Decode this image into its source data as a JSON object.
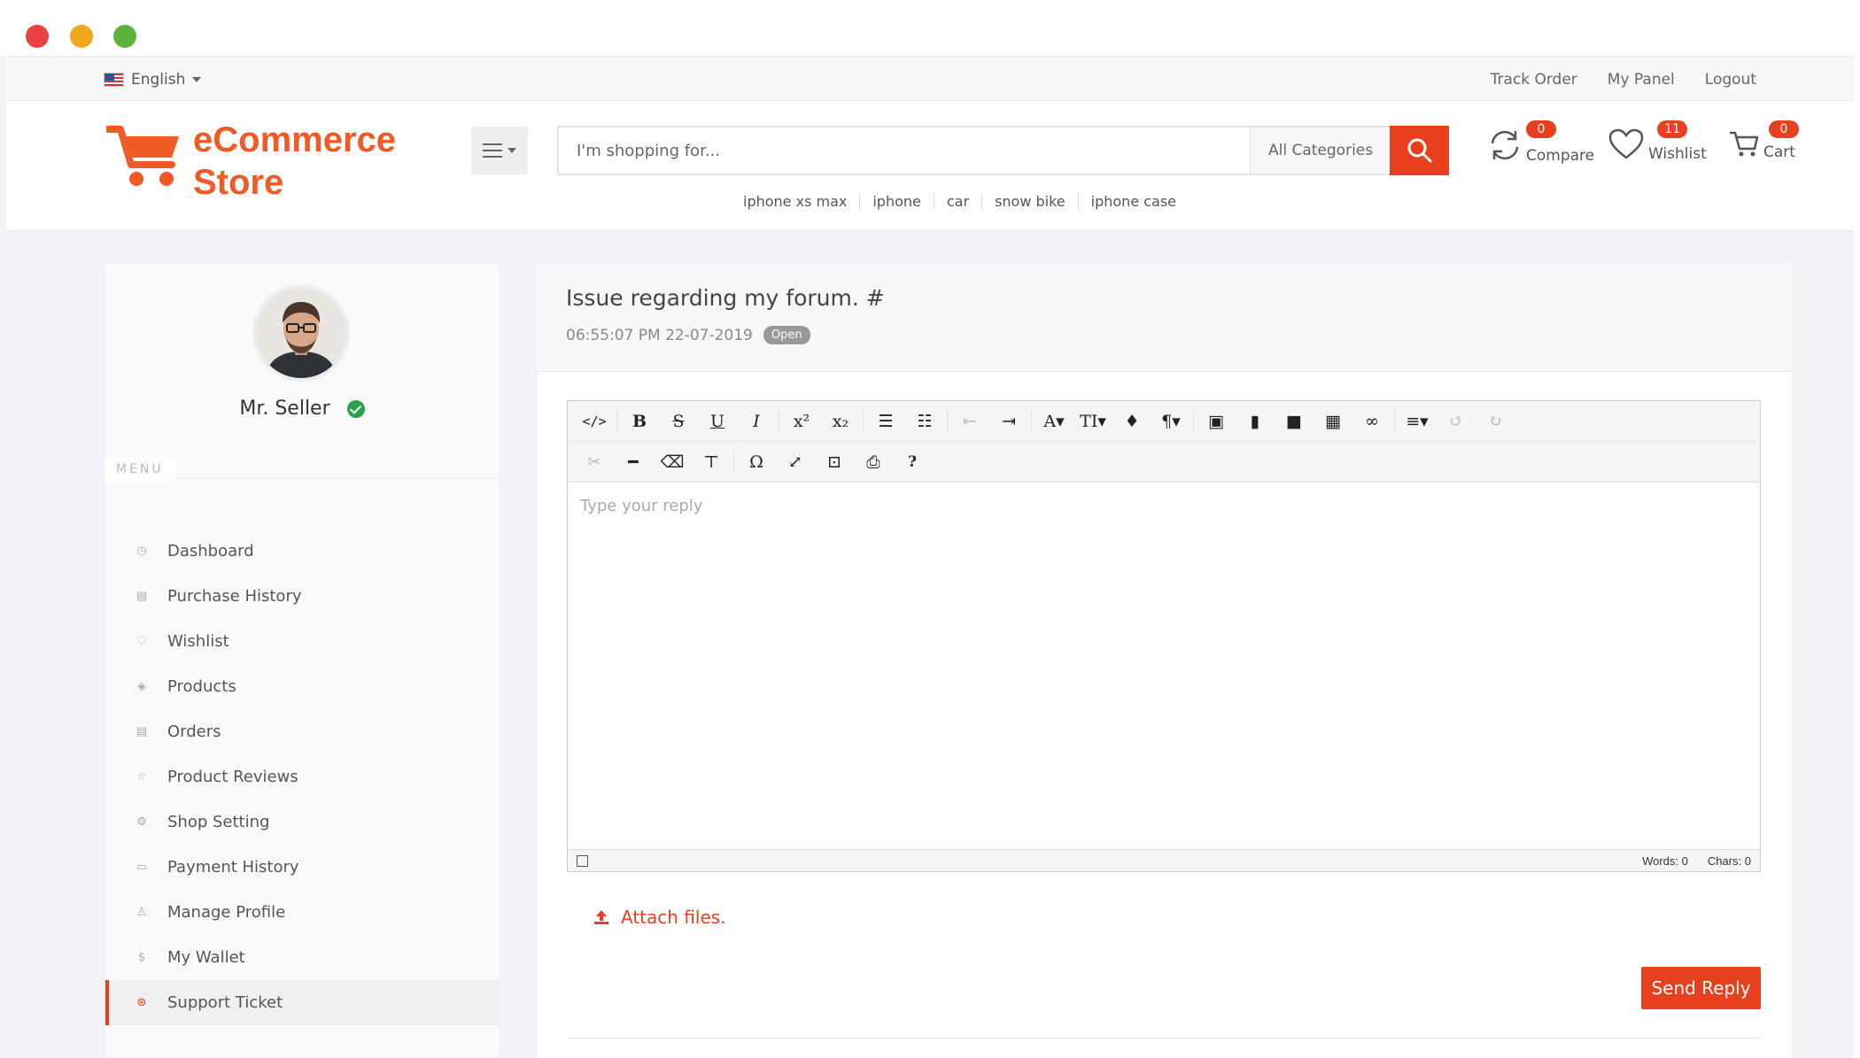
{
  "top_bar": {
    "language": "English",
    "links": [
      "Track Order",
      "My Panel",
      "Logout"
    ]
  },
  "header": {
    "logo_line1": "eCommerce",
    "logo_line2": "Store",
    "search_placeholder": "I'm shopping for...",
    "category": "All Categories",
    "suggestions": [
      "iphone xs max",
      "iphone",
      "car",
      "snow bike",
      "iphone case"
    ],
    "compare": {
      "label": "Compare",
      "count": "0"
    },
    "wishlist": {
      "label": "Wishlist",
      "count": "11"
    },
    "cart": {
      "label": "Cart",
      "count": "0"
    }
  },
  "sidebar": {
    "name": "Mr. Seller",
    "menu_label": "MENU",
    "items": [
      {
        "label": "Dashboard",
        "icon": "dashboard-icon"
      },
      {
        "label": "Purchase History",
        "icon": "file-icon"
      },
      {
        "label": "Wishlist",
        "icon": "heart-icon"
      },
      {
        "label": "Products",
        "icon": "diamond-icon"
      },
      {
        "label": "Orders",
        "icon": "file-icon"
      },
      {
        "label": "Product Reviews",
        "icon": "star-icon"
      },
      {
        "label": "Shop Setting",
        "icon": "gear-icon"
      },
      {
        "label": "Payment History",
        "icon": "money-icon"
      },
      {
        "label": "Manage Profile",
        "icon": "user-icon"
      },
      {
        "label": "My Wallet",
        "icon": "dollar-icon"
      },
      {
        "label": "Support Ticket",
        "icon": "support-icon"
      }
    ],
    "active_index": 10
  },
  "ticket": {
    "title": "Issue regarding my forum. #",
    "timestamp": "06:55:07 PM 22-07-2019",
    "status": "Open"
  },
  "editor": {
    "placeholder": "Type your reply",
    "words": "Words: 0",
    "chars": "Chars: 0"
  },
  "actions": {
    "attach": "Attach files.",
    "send": "Send Reply"
  },
  "colors": {
    "accent": "#e8401f",
    "logo": "#ef5a26"
  }
}
